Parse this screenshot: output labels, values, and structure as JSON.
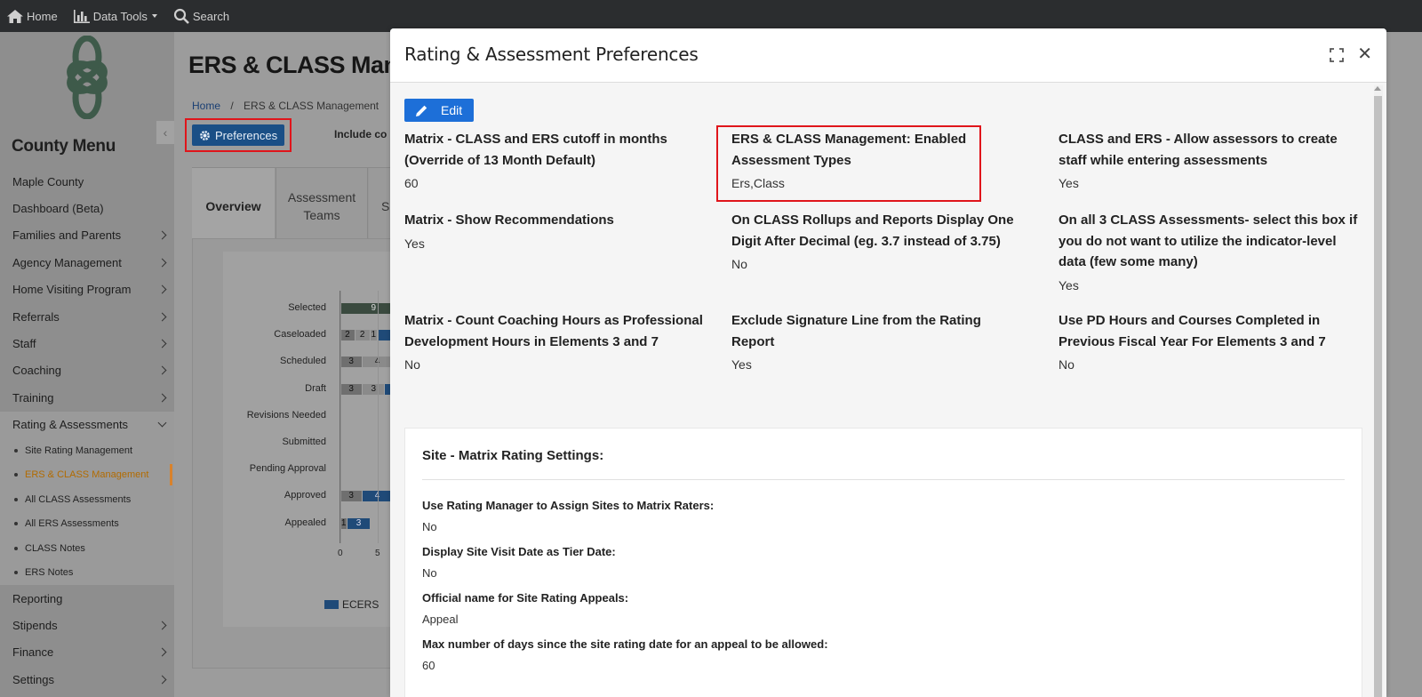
{
  "topbar": {
    "home": "Home",
    "data_tools": "Data Tools",
    "search": "Search"
  },
  "sidebar": {
    "title": "County Menu",
    "items": [
      {
        "label": "Maple County",
        "chevron": false
      },
      {
        "label": "Dashboard (Beta)",
        "chevron": false
      },
      {
        "label": "Families and Parents",
        "chevron": true
      },
      {
        "label": "Agency Management",
        "chevron": true
      },
      {
        "label": "Home Visiting Program",
        "chevron": true
      },
      {
        "label": "Referrals",
        "chevron": true
      },
      {
        "label": "Staff",
        "chevron": true
      },
      {
        "label": "Coaching",
        "chevron": true
      },
      {
        "label": "Training",
        "chevron": true
      }
    ],
    "active_item": "Rating & Assessments",
    "sub_items": [
      "Site Rating Management",
      "ERS & CLASS Management",
      "All CLASS Assessments",
      "All ERS Assessments",
      "CLASS Notes",
      "ERS Notes"
    ],
    "items_after": [
      {
        "label": "Reporting",
        "chevron": false
      },
      {
        "label": "Stipends",
        "chevron": true
      },
      {
        "label": "Finance",
        "chevron": true
      },
      {
        "label": "Settings",
        "chevron": true
      }
    ]
  },
  "page": {
    "title": "ERS & CLASS Manag",
    "breadcrumb_home": "Home",
    "breadcrumb_sep": "/",
    "breadcrumb_current": "ERS & CLASS Management",
    "preferences_label": "Preferences",
    "include_text": "Include co",
    "tabs": [
      "Overview",
      "Assessment Teams",
      "S"
    ]
  },
  "chart_data": {
    "type": "bar",
    "categories": [
      "Selected",
      "Caseloaded",
      "Scheduled",
      "Draft",
      "Revisions Needed",
      "Submitted",
      "Pending Approval",
      "Approved",
      "Appealed"
    ],
    "x_ticks": [
      "0",
      "5"
    ],
    "bars": [
      [
        {
          "v": 9,
          "s": 0,
          "c": "dk"
        }
      ],
      [
        {
          "v": 2,
          "s": 0,
          "c": "gy"
        },
        {
          "v": 2,
          "s": 2,
          "c": "lt"
        },
        {
          "v": 1,
          "s": 4,
          "c": "lt"
        },
        {
          "v": 2,
          "s": 5,
          "c": "bl",
          "hide": true
        }
      ],
      [
        {
          "v": 3,
          "s": 0,
          "c": "gy"
        },
        {
          "v": 4,
          "s": 3,
          "c": "lt"
        },
        {
          "v": 1,
          "s": 7,
          "c": "lt"
        }
      ],
      [
        {
          "v": 3,
          "s": 0,
          "c": "gy"
        },
        {
          "v": 3,
          "s": 3,
          "c": "lt"
        },
        {
          "v": 2,
          "s": 6,
          "c": "bl",
          "hide": true
        }
      ],
      [],
      [],
      [],
      [
        {
          "v": 3,
          "s": 0,
          "c": "gy"
        },
        {
          "v": 4,
          "s": 3,
          "c": "bl"
        }
      ],
      [
        {
          "v": 1,
          "s": 0,
          "c": "gy"
        },
        {
          "v": 3,
          "s": 1,
          "c": "bl"
        }
      ]
    ],
    "legend": [
      "ECERS"
    ]
  },
  "modal": {
    "title": "Rating & Assessment Preferences",
    "edit_label": "Edit",
    "prefs": [
      {
        "label": "Matrix - CLASS and ERS cutoff in months (Override of 13 Month Default)",
        "value": "60"
      },
      {
        "label": "ERS & CLASS Management: Enabled Assessment Types",
        "value": "Ers,Class"
      },
      {
        "label": "CLASS and ERS - Allow assessors to create staff while entering assessments",
        "value": "Yes"
      },
      {
        "label": "Matrix - Show Recommendations",
        "value": "Yes"
      },
      {
        "label": "On CLASS Rollups and Reports Display One Digit After Decimal (eg. 3.7 instead of 3.75)",
        "value": "No"
      },
      {
        "label": "On all 3 CLASS Assessments- select this box if you do not want to utilize the indicator-level data (few some many)",
        "value": "Yes"
      },
      {
        "label": "Matrix - Count Coaching Hours as Professional Development Hours in Elements 3 and 7",
        "value": "No"
      },
      {
        "label": "Exclude Signature Line from the Rating Report",
        "value": "Yes"
      },
      {
        "label": "Use PD Hours and Courses Completed in Previous Fiscal Year For Elements 3 and 7",
        "value": "No"
      }
    ],
    "matrix": {
      "title": "Site - Matrix Rating Settings:",
      "items": [
        {
          "label": "Use Rating Manager to Assign Sites to Matrix Raters:",
          "value": "No"
        },
        {
          "label": "Display Site Visit Date as Tier Date:",
          "value": "No"
        },
        {
          "label": "Official name for Site Rating Appeals:",
          "value": "Appeal"
        },
        {
          "label": "Max number of days since the site rating date for an appeal to be allowed:",
          "value": "60"
        }
      ]
    }
  }
}
